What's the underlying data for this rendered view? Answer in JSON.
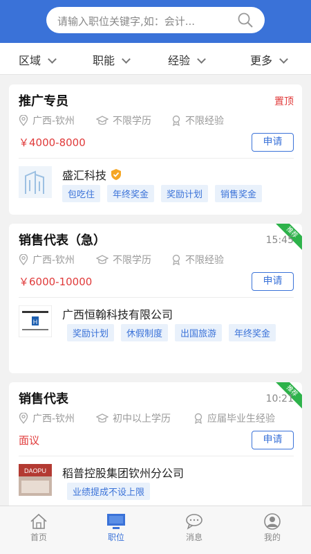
{
  "search": {
    "placeholder": "请输入职位关键字,如：会计..."
  },
  "filters": [
    "区域",
    "职能",
    "经验",
    "更多"
  ],
  "jobs": [
    {
      "title": "推广专员",
      "corner": "置顶",
      "location": "广西-钦州",
      "education": "不限学历",
      "experience": "不限经验",
      "salary": "￥4000-8000",
      "apply": "申请",
      "company": "盛汇科技",
      "tags": [
        "包吃住",
        "年终奖金",
        "奖励计划",
        "销售奖金"
      ]
    },
    {
      "title": "销售代表（急）",
      "corner": "15:45",
      "ribbon": "推荐",
      "location": "广西-钦州",
      "education": "不限学历",
      "experience": "不限经验",
      "salary": "￥6000-10000",
      "apply": "申请",
      "company": "广西恒翰科技有限公司",
      "tags": [
        "奖励计划",
        "休假制度",
        "出国旅游",
        "年终奖金"
      ]
    },
    {
      "title": "销售代表",
      "corner": "10:21",
      "ribbon": "推荐",
      "location": "广西-钦州",
      "education": "初中以上学历",
      "experience": "应届毕业生经验",
      "salary": "面议",
      "apply": "申请",
      "company": "稻普控股集团钦州分公司",
      "tags": [
        "业绩提成不设上限"
      ]
    }
  ],
  "tabs": [
    "首页",
    "职位",
    "消息",
    "我的"
  ],
  "colors": {
    "brand": "#3a72d8",
    "salary": "#e03a3a",
    "ribbon": "#2db24a"
  }
}
